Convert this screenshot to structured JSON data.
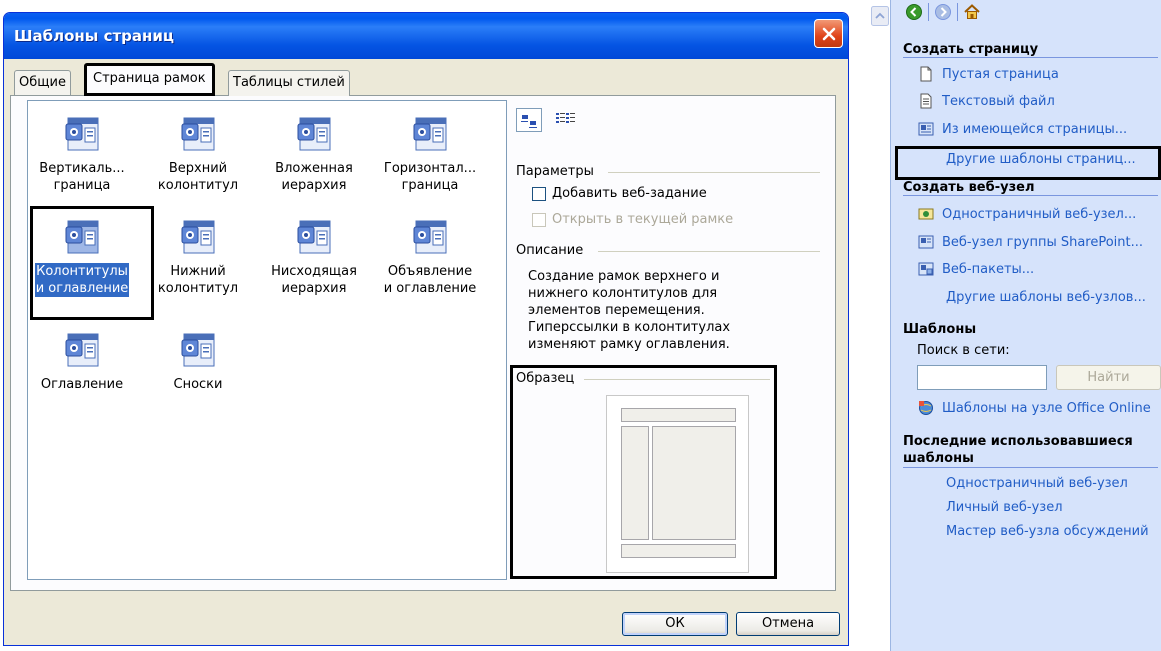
{
  "dialog": {
    "title": "Шаблоны страниц",
    "tabs": [
      "Общие",
      "Страница рамок",
      "Таблицы стилей"
    ],
    "active_tab": "Страница рамок",
    "templates": [
      {
        "line1": "Вертикаль...",
        "line2": "граница"
      },
      {
        "line1": "Верхний",
        "line2": "колонтитул"
      },
      {
        "line1": "Вложенная",
        "line2": "иерархия"
      },
      {
        "line1": "Горизонтал...",
        "line2": "граница"
      },
      {
        "line1": "Колонтитулы",
        "line2": "и оглавление"
      },
      {
        "line1": "Нижний",
        "line2": "колонтитул"
      },
      {
        "line1": "Нисходящая",
        "line2": "иерархия"
      },
      {
        "line1": "Объявление",
        "line2": "и оглавление"
      },
      {
        "line1": "Оглавление",
        "line2": ""
      },
      {
        "line1": "Сноски",
        "line2": ""
      }
    ],
    "selected_template": "Колонтитулы и оглавление",
    "options": {
      "group_label": "Параметры",
      "add_task": "Добавить веб-задание",
      "open_in_frame": "Открыть в текущей рамке"
    },
    "description": {
      "group_label": "Описание",
      "text": "Создание рамок верхнего и нижнего колонтитулов для элементов перемещения. Гиперссылки в колонтитулах изменяют рамку оглавления."
    },
    "preview": {
      "group_label": "Образец"
    },
    "buttons": {
      "ok": "ОК",
      "cancel": "Отмена"
    }
  },
  "task_pane": {
    "create_page": {
      "heading": "Создать страницу",
      "items": [
        "Пустая страница",
        "Текстовый файл",
        "Из имеющейся страницы...",
        "Другие шаблоны страниц..."
      ]
    },
    "create_site": {
      "heading": "Создать веб-узел",
      "items": [
        "Одностраничный веб-узел...",
        "Веб-узел группы SharePoint...",
        "Веб-пакеты...",
        "Другие шаблоны веб-узлов..."
      ]
    },
    "templates": {
      "heading": "Шаблоны",
      "search_label": "Поиск в сети:",
      "search_value": "",
      "find_button": "Найти",
      "online_link": "Шаблоны на узле Office Online"
    },
    "recent": {
      "heading_line1": "Последние использовавшиеся",
      "heading_line2": "шаблоны",
      "items": [
        "Одностраничный веб-узел",
        "Личный веб-узел",
        "Мастер веб-узла обсуждений"
      ]
    }
  }
}
